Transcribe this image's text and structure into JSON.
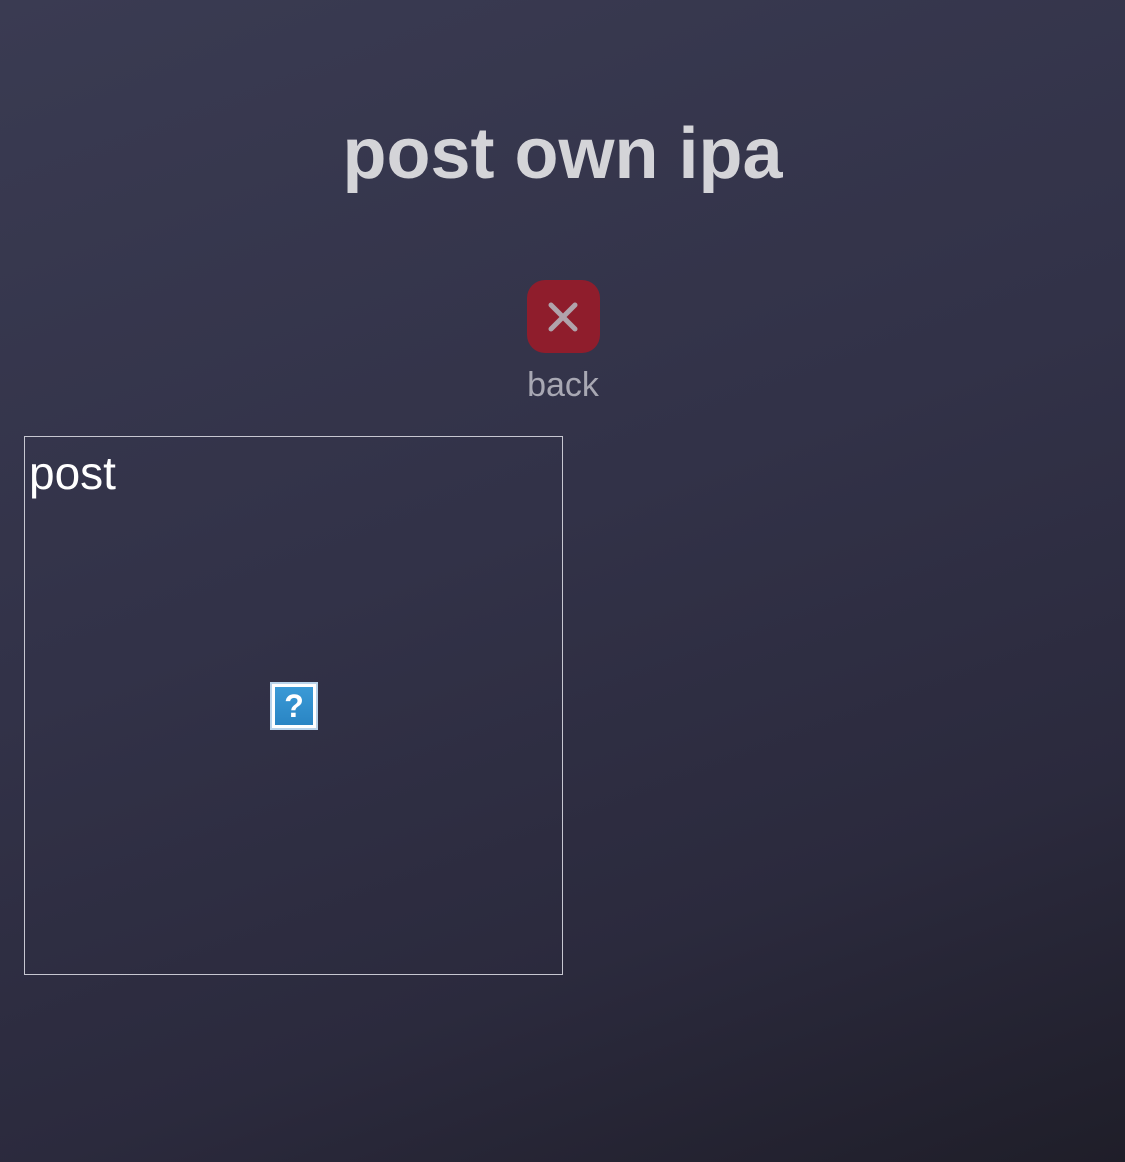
{
  "header": {
    "title": "post own ipa"
  },
  "back": {
    "label": "back",
    "icon": "close-x-icon",
    "color": "#8f1d2c"
  },
  "post_card": {
    "label": "post",
    "image": {
      "icon": "broken-image-icon",
      "glyph": "?"
    }
  }
}
